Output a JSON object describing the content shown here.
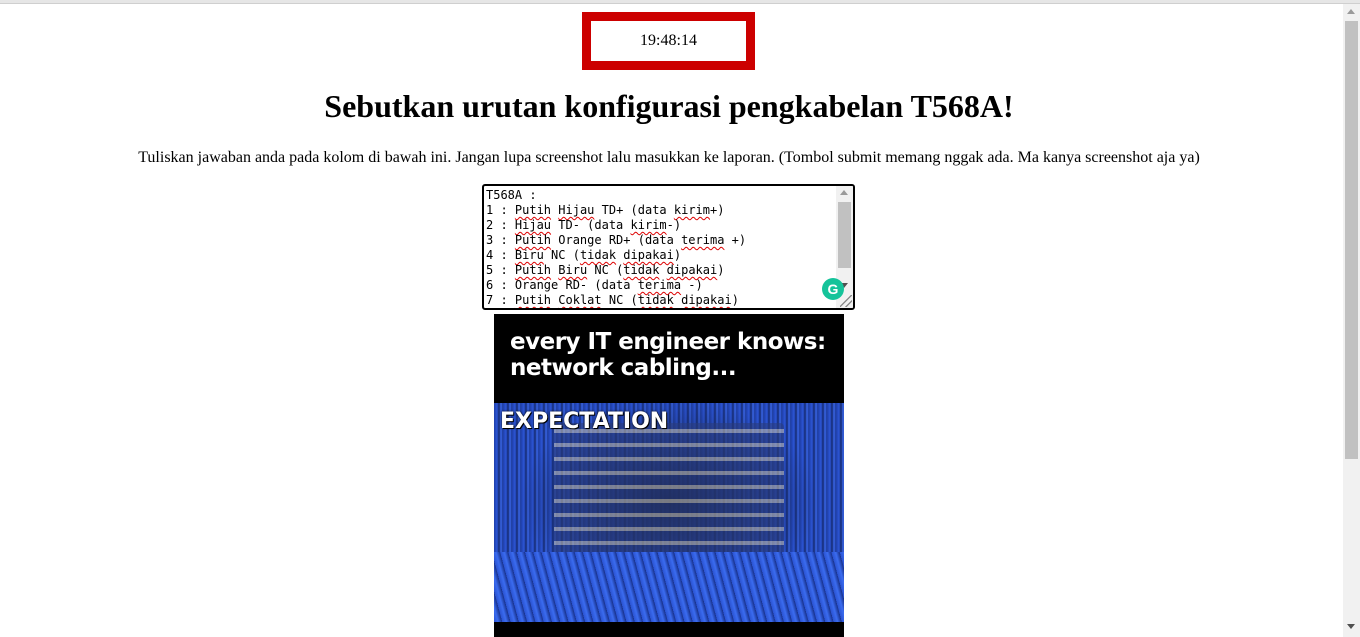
{
  "clock": {
    "time": "19:48:14"
  },
  "question": {
    "title": "Sebutkan urutan konfigurasi pengkabelan T568A!",
    "instructions": "Tuliskan jawaban anda pada kolom di bawah ini. Jangan lupa screenshot lalu masukkan ke laporan. (Tombol submit memang nggak ada. Ma kanya screenshot aja ya)"
  },
  "answer": {
    "lines": [
      "T568A :",
      "1 : Putih Hijau TD+ (data kirim+)",
      "2 : Hijau TD- (data kirim-)",
      "3 : Putih Orange RD+ (data terima +)",
      "4 : Biru NC (tidak dipakai)",
      "5 : Putih Biru NC (tidak dipakai)",
      "6 : Orange RD- (data terima -)",
      "7 : Putih Coklat NC (tidak dipakai)"
    ],
    "grammarly_glyph": "G"
  },
  "meme": {
    "caption_line1": "every IT engineer knows:",
    "caption_line2": "network cabling...",
    "label": "EXPECTATION"
  },
  "colors": {
    "clock_border": "#cc0000",
    "grammarly": "#15c39a",
    "cable_blue": "#2c55d6"
  },
  "icons": {
    "grammarly": "grammarly-icon",
    "scroll_up": "chevron-up-icon",
    "scroll_down": "chevron-down-icon",
    "resize": "resize-grip-icon"
  }
}
